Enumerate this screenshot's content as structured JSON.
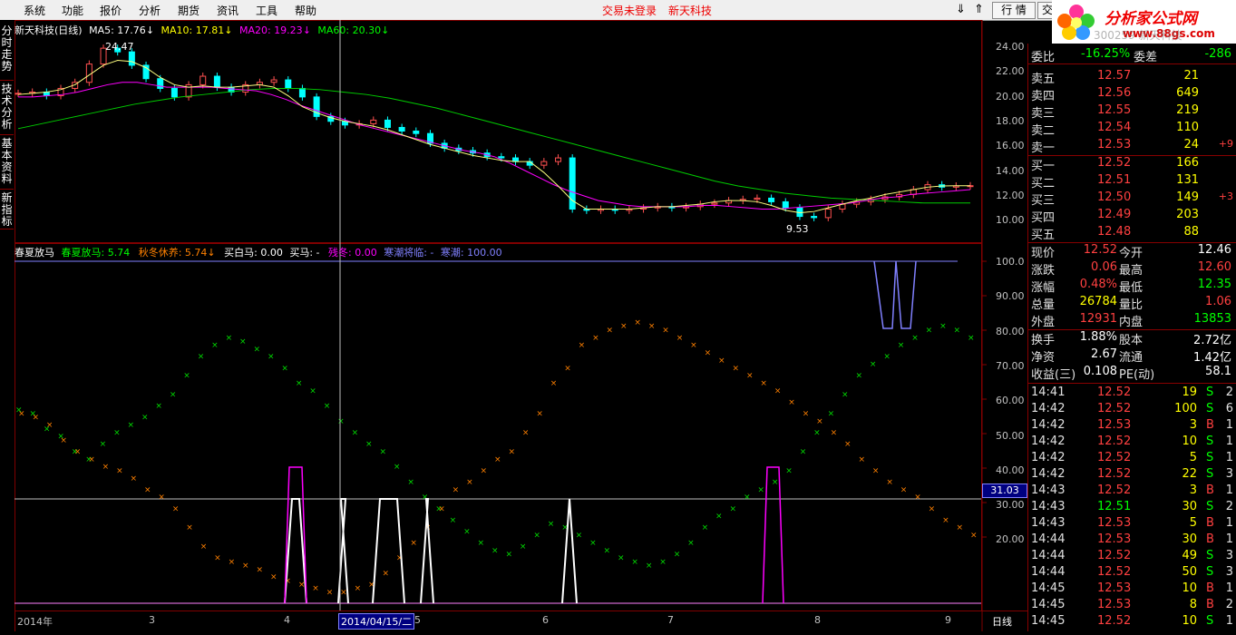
{
  "menu": [
    "系统",
    "功能",
    "报价",
    "分析",
    "期货",
    "资讯",
    "工具",
    "帮助"
  ],
  "status": {
    "login": "交易未登录",
    "stock": "新天科技"
  },
  "buttons": {
    "quote": "行 情",
    "trade": "交"
  },
  "logo": {
    "text": "分析家公式网",
    "url": "www.88gs.com"
  },
  "header_code": "300259 新天科技",
  "left_tabs": [
    "分时走势",
    "技术分析",
    "基本资料",
    "新指标"
  ],
  "price_legend": {
    "title": "新天科技(日线)",
    "items": [
      {
        "label": "MA5: 17.76",
        "color": "#ffffff"
      },
      {
        "label": "MA10: 17.81",
        "color": "#ffff00"
      },
      {
        "label": "MA20: 19.23",
        "color": "#ff00ff"
      },
      {
        "label": "MA60: 20.30",
        "color": "#00ff00"
      }
    ],
    "high_label": "24.47",
    "low_label": "9.53"
  },
  "price_axis": [
    "24.00",
    "22.00",
    "20.00",
    "18.00",
    "16.00",
    "14.00",
    "12.00",
    "10.00"
  ],
  "ind_legend": {
    "items": [
      {
        "label": "春夏放马",
        "color": "#ffffff"
      },
      {
        "label": "春夏放马: 5.74",
        "color": "#00ff00"
      },
      {
        "label": "秋冬休养: 5.74",
        "color": "#ff8000"
      },
      {
        "label": "买白马: 0.00",
        "color": "#ffffff"
      },
      {
        "label": "买马: -",
        "color": "#ffffff"
      },
      {
        "label": "残冬: 0.00",
        "color": "#ff00ff"
      },
      {
        "label": "寒潮将临: -",
        "color": "#8080ff"
      },
      {
        "label": "寒潮: 100.00",
        "color": "#8080ff"
      }
    ]
  },
  "ind_axis": [
    "100.0",
    "90.00",
    "80.00",
    "70.00",
    "60.00",
    "50.00",
    "40.00",
    "30.00",
    "20.00"
  ],
  "crosshair_value": "31.03",
  "x_axis": {
    "start": "2014年",
    "ticks": [
      "3",
      "4",
      "5",
      "6",
      "7",
      "8",
      "9"
    ],
    "cursor_date": "2014/04/15/二",
    "period": "日线"
  },
  "quote": {
    "webi": {
      "label": "委比",
      "value": "-16.25%",
      "label2": "委差",
      "value2": "-286"
    },
    "asks": [
      {
        "label": "卖五",
        "price": "12.57",
        "vol": "21",
        "chg": ""
      },
      {
        "label": "卖四",
        "price": "12.56",
        "vol": "649",
        "chg": ""
      },
      {
        "label": "卖三",
        "price": "12.55",
        "vol": "219",
        "chg": ""
      },
      {
        "label": "卖二",
        "price": "12.54",
        "vol": "110",
        "chg": ""
      },
      {
        "label": "卖一",
        "price": "12.53",
        "vol": "24",
        "chg": "+9"
      }
    ],
    "bids": [
      {
        "label": "买一",
        "price": "12.52",
        "vol": "166",
        "chg": ""
      },
      {
        "label": "买二",
        "price": "12.51",
        "vol": "131",
        "chg": ""
      },
      {
        "label": "买三",
        "price": "12.50",
        "vol": "149",
        "chg": "+3"
      },
      {
        "label": "买四",
        "price": "12.49",
        "vol": "203",
        "chg": ""
      },
      {
        "label": "买五",
        "price": "12.48",
        "vol": "88",
        "chg": ""
      }
    ],
    "stats1": [
      {
        "l1": "现价",
        "v1": "12.52",
        "l2": "今开",
        "v2": "12.46",
        "c1": "#ff4040",
        "c2": "#ffffff"
      },
      {
        "l1": "涨跌",
        "v1": "0.06",
        "l2": "最高",
        "v2": "12.60",
        "c1": "#ff4040",
        "c2": "#ff4040"
      },
      {
        "l1": "涨幅",
        "v1": "0.48%",
        "l2": "最低",
        "v2": "12.35",
        "c1": "#ff4040",
        "c2": "#00ff00"
      },
      {
        "l1": "总量",
        "v1": "26784",
        "l2": "量比",
        "v2": "1.06",
        "c1": "#ffff00",
        "c2": "#ff4040"
      },
      {
        "l1": "外盘",
        "v1": "12931",
        "l2": "内盘",
        "v2": "13853",
        "c1": "#ff4040",
        "c2": "#00ff00"
      }
    ],
    "stats2": [
      {
        "l1": "换手",
        "v1": "1.88%",
        "l2": "股本",
        "v2": "2.72亿"
      },
      {
        "l1": "净资",
        "v1": "2.67",
        "l2": "流通",
        "v2": "1.42亿"
      },
      {
        "l1": "收益(三)",
        "v1": "0.108",
        "l2": "PE(动)",
        "v2": "58.1"
      }
    ],
    "ticks": [
      {
        "t": "14:41",
        "p": "12.52",
        "v": "19",
        "s": "S",
        "n": "2"
      },
      {
        "t": "14:42",
        "p": "12.52",
        "v": "100",
        "s": "S",
        "n": "6"
      },
      {
        "t": "14:42",
        "p": "12.53",
        "v": "3",
        "s": "B",
        "n": "1"
      },
      {
        "t": "14:42",
        "p": "12.52",
        "v": "10",
        "s": "S",
        "n": "1"
      },
      {
        "t": "14:42",
        "p": "12.52",
        "v": "5",
        "s": "S",
        "n": "1"
      },
      {
        "t": "14:42",
        "p": "12.52",
        "v": "22",
        "s": "S",
        "n": "3"
      },
      {
        "t": "14:43",
        "p": "12.52",
        "v": "3",
        "s": "B",
        "n": "1"
      },
      {
        "t": "14:43",
        "p": "12.51",
        "v": "30",
        "s": "S",
        "n": "2"
      },
      {
        "t": "14:43",
        "p": "12.53",
        "v": "5",
        "s": "B",
        "n": "1"
      },
      {
        "t": "14:44",
        "p": "12.53",
        "v": "30",
        "s": "B",
        "n": "1"
      },
      {
        "t": "14:44",
        "p": "12.52",
        "v": "49",
        "s": "S",
        "n": "3"
      },
      {
        "t": "14:44",
        "p": "12.52",
        "v": "50",
        "s": "S",
        "n": "3"
      },
      {
        "t": "14:45",
        "p": "12.53",
        "v": "10",
        "s": "B",
        "n": "1"
      },
      {
        "t": "14:45",
        "p": "12.53",
        "v": "8",
        "s": "B",
        "n": "2"
      },
      {
        "t": "14:45",
        "p": "12.52",
        "v": "10",
        "s": "S",
        "n": "1"
      }
    ]
  },
  "chart_data": {
    "type": "line",
    "price_series": {
      "close": [
        20.1,
        20.2,
        19.9,
        20.5,
        21.0,
        22.5,
        23.8,
        23.5,
        22.4,
        21.3,
        20.5,
        19.8,
        20.8,
        21.5,
        20.6,
        20.2,
        20.8,
        21.0,
        21.2,
        20.5,
        19.8,
        18.2,
        17.8,
        17.5,
        17.6,
        17.9,
        17.3,
        17.0,
        16.8,
        16.0,
        15.6,
        15.4,
        15.2,
        14.9,
        14.8,
        14.5,
        14.2,
        14.5,
        14.8,
        10.6,
        10.5,
        10.6,
        10.5,
        10.6,
        10.7,
        10.8,
        10.7,
        10.8,
        11.0,
        11.1,
        11.3,
        11.4,
        11.5,
        11.2,
        10.7,
        10.0,
        9.9,
        10.6,
        11.0,
        11.2,
        11.4,
        11.6,
        11.8,
        12.2,
        12.6,
        12.4,
        12.5,
        12.52
      ],
      "ma5": [
        20.0,
        20.1,
        20.2,
        20.4,
        20.8,
        21.6,
        22.4,
        22.8,
        22.7,
        22.2,
        21.4,
        20.8,
        20.6,
        20.7,
        20.6,
        20.6,
        20.7,
        20.8,
        20.6,
        19.9,
        19.0,
        18.5,
        18.1,
        17.8,
        17.6,
        17.4,
        17.1,
        16.7,
        16.3,
        15.9,
        15.6,
        15.3,
        15.0,
        14.8,
        14.6,
        14.5,
        14.5,
        13.6,
        12.5,
        11.3,
        10.6,
        10.6,
        10.6,
        10.6,
        10.7,
        10.8,
        10.8,
        10.9,
        11.0,
        11.2,
        11.3,
        11.3,
        11.2,
        10.9,
        10.5,
        10.3,
        10.4,
        10.7,
        11.0,
        11.3,
        11.5,
        11.8,
        12.0,
        12.2,
        12.4,
        12.5,
        12.52,
        12.52
      ],
      "ma20": [
        19.8,
        19.8,
        19.9,
        20.0,
        20.2,
        20.5,
        20.8,
        21.0,
        21.0,
        20.8,
        20.6,
        20.6,
        20.6,
        20.6,
        20.5,
        20.4,
        20.3,
        20.0,
        19.6,
        19.1,
        18.7,
        18.3,
        17.9,
        17.5,
        17.2,
        16.9,
        16.6,
        16.3,
        16.0,
        15.7,
        15.4,
        15.2,
        14.9,
        14.4,
        13.8,
        13.2,
        12.6,
        12.1,
        11.7,
        11.3,
        11.1,
        10.9,
        10.8,
        10.8,
        10.8,
        10.8,
        10.9,
        10.9,
        10.8,
        10.7,
        10.6,
        10.6,
        10.7,
        10.8,
        10.9,
        11.0,
        11.1,
        11.3,
        11.5,
        11.6,
        11.8,
        11.9,
        12.0,
        12.1,
        12.2
      ],
      "ma60": [
        17.2,
        17.6,
        18.0,
        18.4,
        18.8,
        19.2,
        19.5,
        19.8,
        20.0,
        20.2,
        20.4,
        20.5,
        20.5,
        20.4,
        20.2,
        20.0,
        19.7,
        19.3,
        18.9,
        18.4,
        17.9,
        17.4,
        16.9,
        16.4,
        15.9,
        15.4,
        14.9,
        14.4,
        13.9,
        13.4,
        12.9,
        12.5,
        12.2,
        11.9,
        11.7,
        11.5,
        11.4,
        11.3,
        11.2,
        11.1,
        11.1,
        11.1
      ]
    },
    "ind_series": {
      "chunxia": [
        61,
        60,
        56,
        54,
        50,
        48,
        52,
        55,
        57,
        59,
        62,
        65,
        70,
        75,
        78,
        80,
        79,
        77,
        75,
        72,
        68,
        66,
        62,
        58,
        55,
        52,
        50,
        46,
        42,
        38,
        35,
        32,
        29,
        26,
        24,
        23,
        25,
        28,
        31,
        30,
        28,
        26,
        24,
        22,
        21,
        20,
        21,
        23,
        26,
        30,
        33,
        35,
        38,
        40,
        42,
        45,
        50,
        55,
        60,
        65,
        70,
        73,
        75,
        78,
        80,
        82,
        83,
        82,
        80
      ],
      "qiudong": [
        60,
        59,
        57,
        53,
        50,
        48,
        46,
        45,
        43,
        40,
        38,
        35,
        30,
        25,
        22,
        21,
        20,
        19,
        17,
        16,
        15,
        14,
        13,
        13,
        14,
        15,
        18,
        22,
        26,
        30,
        35,
        40,
        42,
        45,
        48,
        50,
        55,
        60,
        68,
        72,
        78,
        80,
        82,
        83,
        84,
        83,
        82,
        80,
        78,
        76,
        74,
        72,
        70,
        68,
        66,
        63,
        60,
        58,
        55,
        52,
        48,
        45,
        42,
        40,
        38,
        35,
        32,
        30,
        28
      ]
    },
    "price_ylim": [
      9,
      25
    ],
    "ind_ylim": [
      10,
      100
    ]
  }
}
